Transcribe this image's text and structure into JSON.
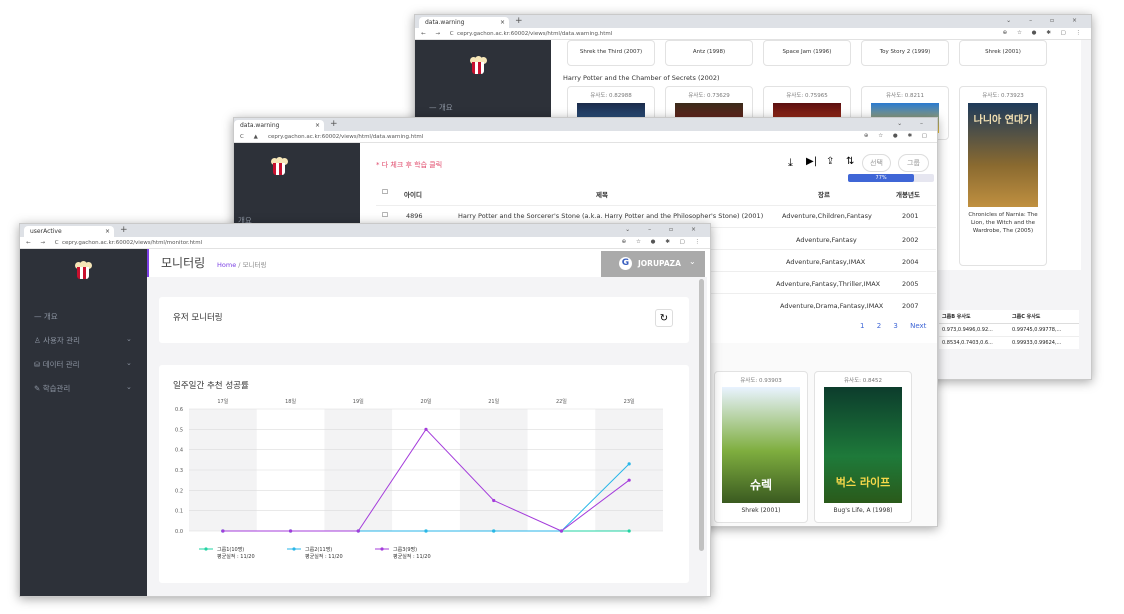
{
  "winA": {
    "tab_title": "data.warning",
    "url": "cepry.gachon.ac.kr:60002/views/html/data.warning.html",
    "menu_overview": "개요",
    "top_titles": [
      "Shrek the Third (2007)",
      "Antz (1998)",
      "Space Jam (1996)",
      "Toy Story 2 (1999)",
      "Shrek (2001)"
    ],
    "section_title": "Harry Potter and the Chamber of Secrets (2002)",
    "sims": [
      "유사도: 0.82988",
      "유사도: 0.73629",
      "유사도: 0.75965",
      "유사도: 0.8211",
      "유사도: 0.73923"
    ],
    "narnia_title": "Chronicles of Narnia: The Lion, the Witch and the Wardrobe, The (2005)",
    "narnia_poster_text": "나니아 연대기",
    "sim_table_headers": [
      "그룹B 유사도",
      "그룹C 유사도"
    ],
    "sim_table_rows": [
      [
        "0.973,0.9496,0.92...",
        "0.99745,0.99778,..."
      ],
      [
        "0.8534,0.7403,0.6...",
        "0.99933,0.99624,..."
      ]
    ]
  },
  "winB": {
    "tab_title": "data.warning",
    "url": "cepry.gachon.ac.kr:60002/views/html/data.warning.html",
    "menu_overview": "개요",
    "notice": "* 다 체크 후 학습 클릭",
    "btn_learn": "선택",
    "btn_group": "그룹",
    "progress": 0.77,
    "progress_label": "77%",
    "headers": {
      "id": "아이디",
      "title": "제목",
      "genre": "장르",
      "year": "개봉년도"
    },
    "rows": [
      {
        "id": "4896",
        "title": "Harry Potter and the Sorcerer's Stone (a.k.a. Harry Potter and the Philosopher's Stone) (2001)",
        "genre": "Adventure,Children,Fantasy",
        "year": "2001"
      },
      {
        "id": "",
        "title": "",
        "genre": "Adventure,Fantasy",
        "year": "2002"
      },
      {
        "id": "",
        "title": "",
        "genre": "Adventure,Fantasy,IMAX",
        "year": "2004"
      },
      {
        "id": "",
        "title": "",
        "genre": "Adventure,Fantasy,Thriller,IMAX",
        "year": "2005"
      },
      {
        "id": "",
        "title": "",
        "genre": "Adventure,Drama,Fantasy,IMAX",
        "year": "2007"
      }
    ],
    "pages": [
      "1",
      "2",
      "3"
    ],
    "next_label": "Next",
    "movies": [
      {
        "sim": "유사도: 0.93903",
        "title": "Shrek (2001)",
        "poster_text": "슈렉"
      },
      {
        "sim": "유사도: 0.8452",
        "title": "Bug's Life, A (1998)",
        "poster_text": "벅스 라이프"
      }
    ]
  },
  "winC": {
    "tab_title": "userActive",
    "url": "cepry.gachon.ac.kr:60002/views/html/monitor.html",
    "page_title": "모니터링",
    "breadcrumb_home": "Home",
    "breadcrumb_sep": "/",
    "breadcrumb_current": "모니터링",
    "user_name": "JORUPAZA",
    "menu": [
      {
        "label": "개요",
        "icon": "dash-icon",
        "has_chevron": false
      },
      {
        "label": "사용자 관리",
        "icon": "user-icon",
        "has_chevron": true
      },
      {
        "label": "데이터 관리",
        "icon": "database-icon",
        "has_chevron": true
      },
      {
        "label": "학습관리",
        "icon": "pencil-icon",
        "has_chevron": true
      }
    ],
    "user_monitor_title": "유저 모니터링",
    "chart_title": "일주일간 추천 성공률"
  },
  "chart_data": {
    "type": "line",
    "title": "일주일간 추천 성공률",
    "x": [
      "17일",
      "18일",
      "19일",
      "20일",
      "21일",
      "22일",
      "23일"
    ],
    "ylim": [
      0,
      0.6
    ],
    "yticks": [
      "0.0",
      "0.1",
      "0.2",
      "0.3",
      "0.4",
      "0.5",
      "0.6"
    ],
    "grid": true,
    "legend_position": "bottom-left",
    "series": [
      {
        "name": "그룹1(10명)",
        "sub": "평균실적 : 11/20",
        "color": "#22d3a3",
        "values": [
          0,
          0,
          0,
          0,
          0,
          0,
          0
        ]
      },
      {
        "name": "그룹2(11명)",
        "sub": "평균실적 : 11/20",
        "color": "#29b6e8",
        "values": [
          0,
          0,
          0,
          0,
          0,
          0,
          0.33
        ]
      },
      {
        "name": "그룹3(9명)",
        "sub": "평균실적 : 11/20",
        "color": "#a43cdb",
        "values": [
          0,
          0,
          0,
          0.5,
          0.15,
          0,
          0.25
        ]
      }
    ]
  }
}
